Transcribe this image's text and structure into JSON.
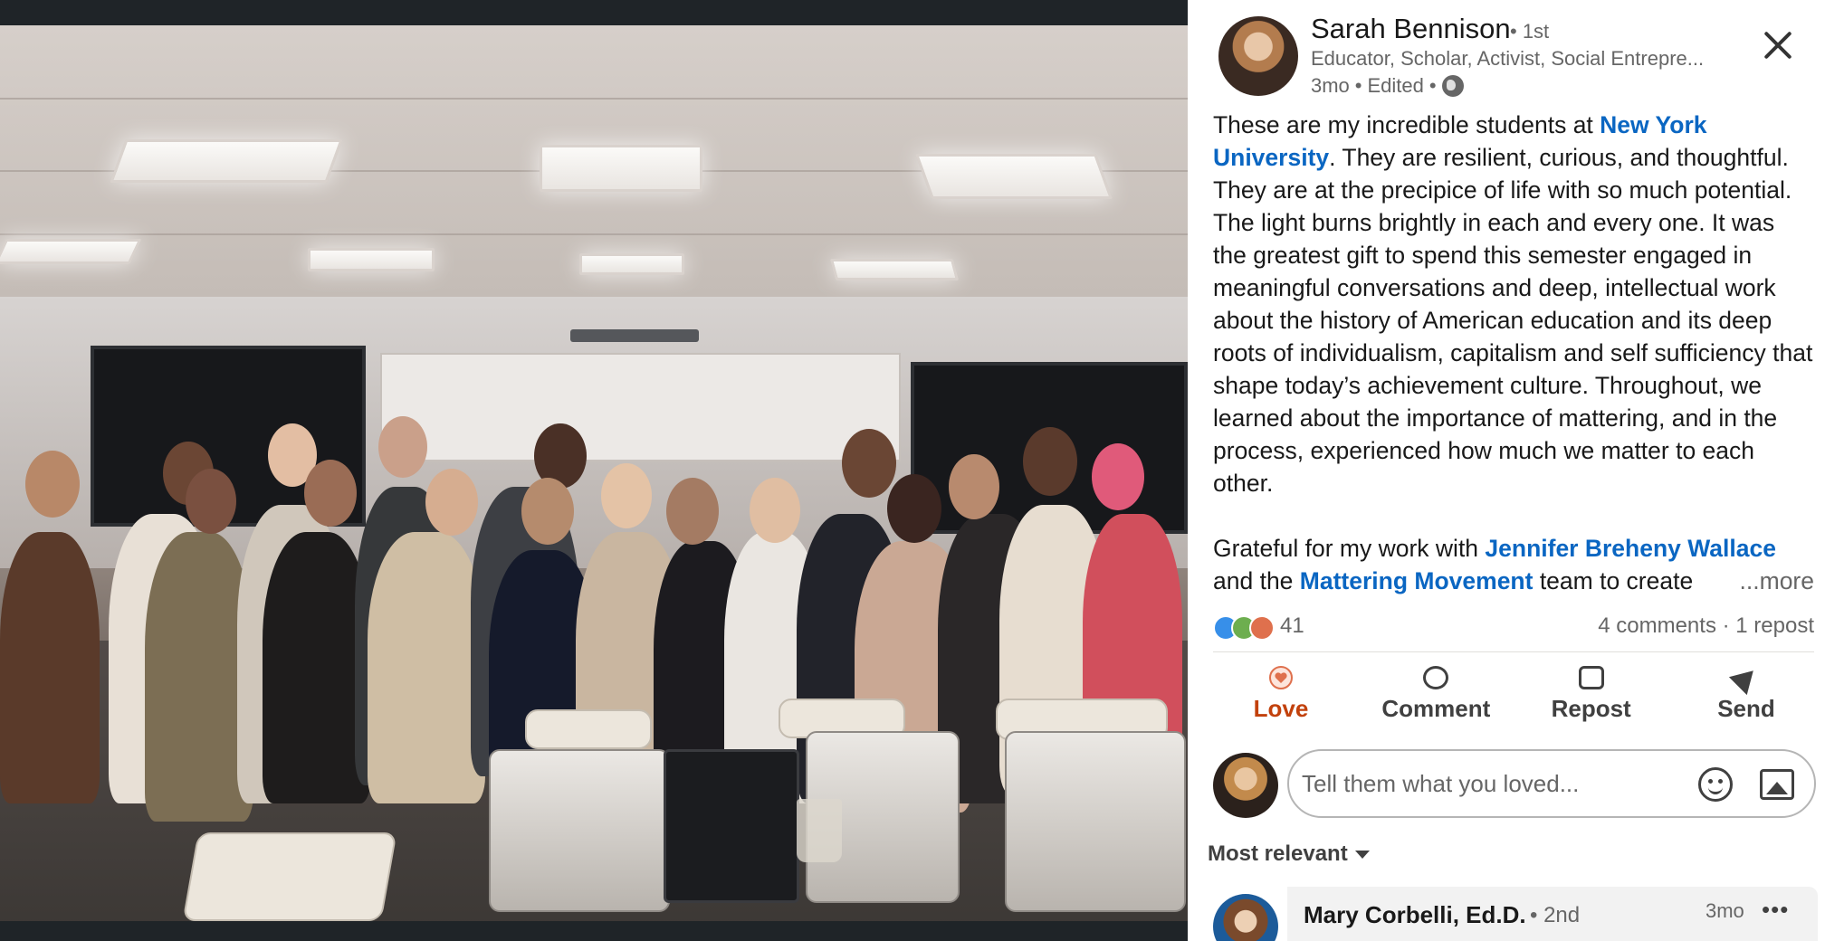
{
  "author": {
    "name": "Sarah Bennison",
    "degree": "• 1st",
    "headline": "Educator, Scholar, Activist, Social Entrepre...",
    "time": "3mo",
    "edited": "Edited",
    "sep": "•"
  },
  "post": {
    "p1_a": "These are my incredible students at ",
    "p1_link": "New York University",
    "p1_b": ". They are resilient, curious, and thoughtful. They are at the precipice of life with so much potential. The light burns brightly in each and every one. It was the greatest gift to spend this semester engaged in meaningful conversations and deep, intellectual work about the history of American education and its deep roots of individualism, capitalism and self sufficiency that shape today’s achievement culture. Throughout, we learned about the importance of mattering, and in the process, experienced how much we matter to each other.",
    "p2_a": "Grateful for my work with ",
    "p2_link1": "Jennifer Breheny Wallace",
    "p2_b": " and the ",
    "p2_link2": "Mattering Movement",
    "p2_c": " team to create",
    "more": "...more"
  },
  "social": {
    "reaction_count": "41",
    "comments_reposts": "4 comments · 1 repost",
    "reaction_types": [
      "like-icon",
      "support-icon",
      "love-icon"
    ]
  },
  "actions": {
    "love": "Love",
    "comment": "Comment",
    "repost": "Repost",
    "send": "Send"
  },
  "comment_box": {
    "placeholder": "Tell them what you loved..."
  },
  "comments": {
    "sort_label": "Most relevant",
    "first": {
      "name": "Mary Corbelli, Ed.D.",
      "degree": "• 2nd",
      "time": "3mo",
      "more": "•••"
    }
  },
  "colors": {
    "link": "#0a66c2",
    "love_accent": "#c2410c",
    "backdrop": "#1d2226"
  }
}
